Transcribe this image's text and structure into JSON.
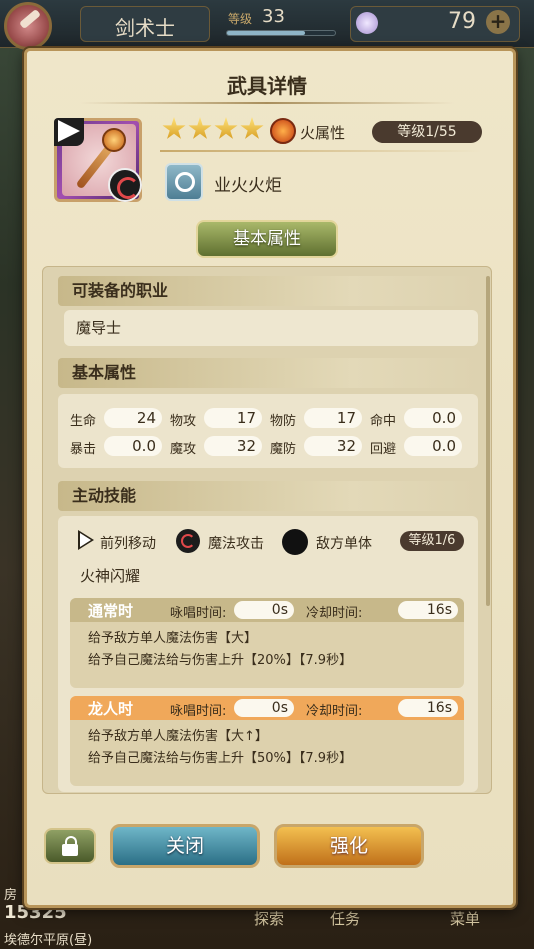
{
  "header": {
    "class_name": "剑术士",
    "level_label": "等级",
    "level": "33",
    "level_progress": 0.72,
    "gems": "79",
    "plus": "+"
  },
  "background": {
    "fang": "房",
    "number": "15325",
    "location": "埃德尔平原(昼)",
    "nav": [
      "探索",
      "任务",
      "菜单"
    ]
  },
  "dialog": {
    "title": "武具详情",
    "stars": 4,
    "element_label": "火属性",
    "level_text": "等级1/55",
    "weapon_name": "业火火炬",
    "tab_label": "基本属性",
    "sections": {
      "jobs": "可装备的职业",
      "basic": "基本属性",
      "active": "主动技能"
    },
    "job": "魔导士",
    "attributes": [
      {
        "label": "生命",
        "value": "24"
      },
      {
        "label": "物攻",
        "value": "17"
      },
      {
        "label": "物防",
        "value": "17"
      },
      {
        "label": "命中",
        "value": "0.0"
      },
      {
        "label": "暴击",
        "value": "0.0"
      },
      {
        "label": "魔攻",
        "value": "32"
      },
      {
        "label": "魔防",
        "value": "32"
      },
      {
        "label": "回避",
        "value": "0.0"
      }
    ],
    "skill": {
      "tags": [
        "前列移动",
        "魔法攻击",
        "敌方单体"
      ],
      "level": "等级1/6",
      "name": "火神闪耀",
      "modes": [
        {
          "title": "通常时",
          "cast_label": "咏唱时间:",
          "cast": "0s",
          "cd_label": "冷却时间:",
          "cd": "16s",
          "lines": [
            "给予敌方单人魔法伤害【大】",
            "给予自己魔法给与伤害上升【20%】【7.9秒】"
          ],
          "head_color": "#c7b88a",
          "title_color": "#ffffff"
        },
        {
          "title": "龙人时",
          "cast_label": "咏唱时间:",
          "cast": "0s",
          "cd_label": "冷却时间:",
          "cd": "16s",
          "lines": [
            "给予敌方单人魔法伤害【大↑】",
            "给予自己魔法给与伤害上升【50%】【7.9秒】"
          ],
          "head_color": "#f0a85a",
          "title_color": "#ffffff"
        }
      ]
    },
    "buttons": {
      "close": "关闭",
      "upgrade": "强化"
    }
  }
}
